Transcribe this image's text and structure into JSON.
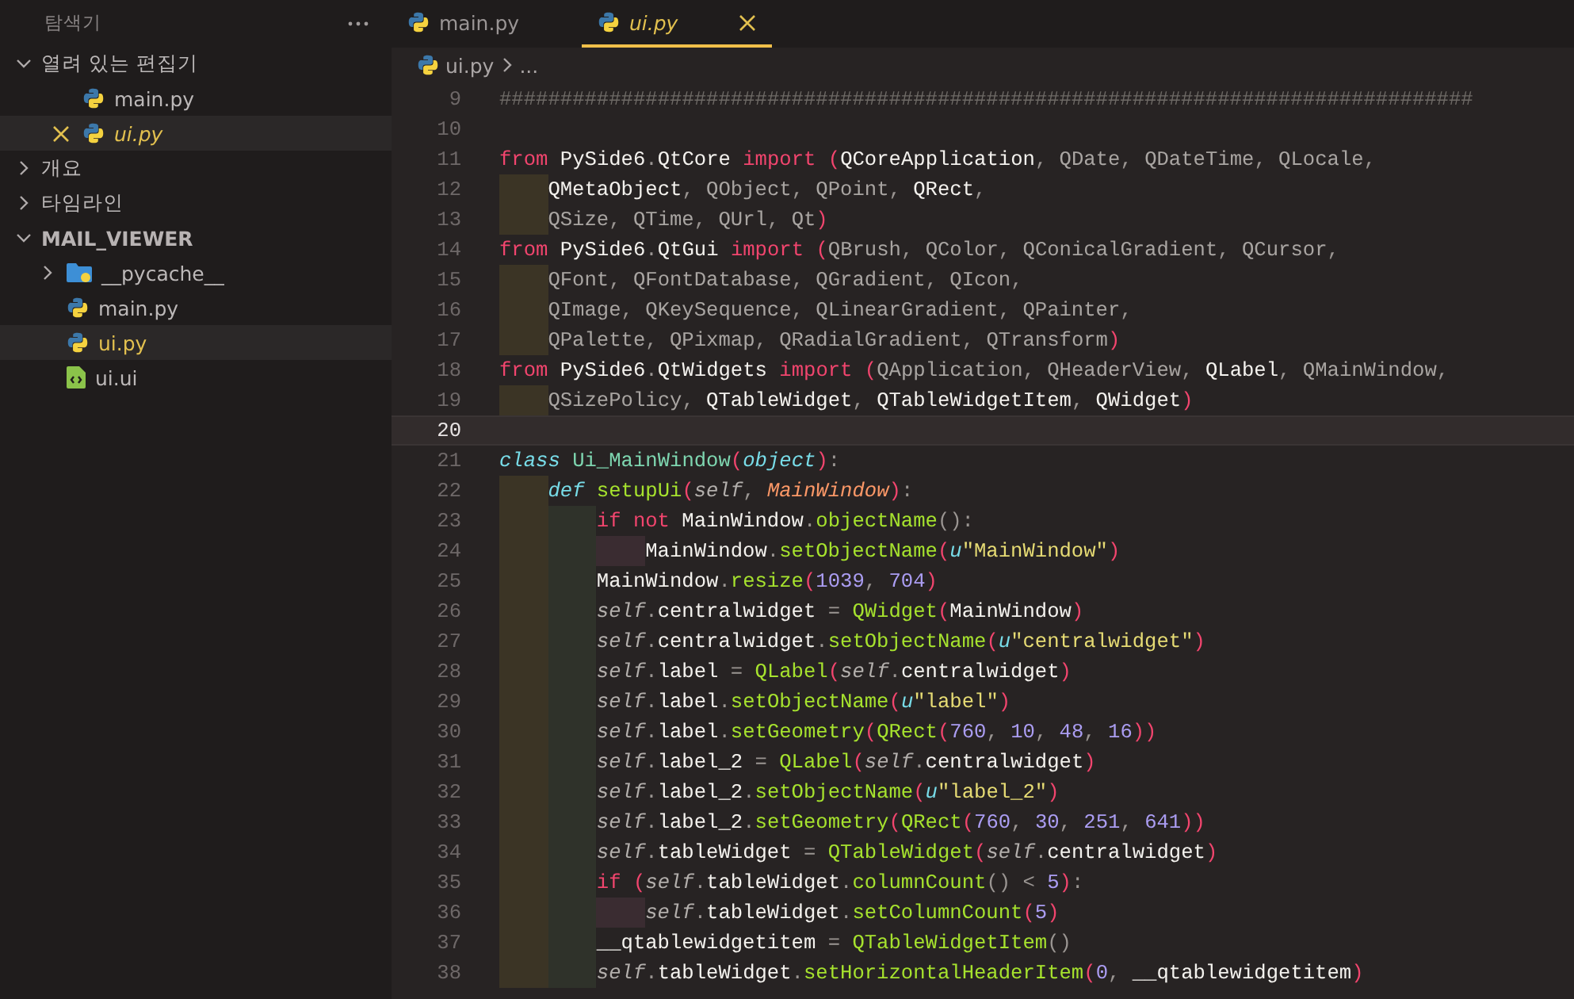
{
  "sidebar": {
    "title": "탐색기",
    "sections": [
      {
        "label": "열려 있는 편집기",
        "expanded": true,
        "bold": false,
        "items": [
          {
            "name": "main.py",
            "kind": "python",
            "selected": false,
            "modified": false,
            "preview": false,
            "close": false
          },
          {
            "name": "ui.py",
            "kind": "python",
            "selected": true,
            "modified": true,
            "preview": true,
            "close": true
          }
        ]
      },
      {
        "label": "개요",
        "expanded": false,
        "bold": false
      },
      {
        "label": "타임라인",
        "expanded": false,
        "bold": false
      },
      {
        "label": "MAIL_VIEWER",
        "expanded": true,
        "bold": true,
        "items": [
          {
            "name": "__pycache__",
            "kind": "folder",
            "expanded": false,
            "selected": false,
            "modified": false
          },
          {
            "name": "main.py",
            "kind": "python",
            "selected": false,
            "modified": false
          },
          {
            "name": "ui.py",
            "kind": "python",
            "selected": true,
            "modified": true
          },
          {
            "name": "ui.ui",
            "kind": "xml",
            "selected": false,
            "modified": false
          }
        ]
      }
    ]
  },
  "tabs": [
    {
      "label": "main.py",
      "selected": false,
      "preview": false,
      "modified": false
    },
    {
      "label": "ui.py",
      "selected": true,
      "preview": true,
      "modified": true
    }
  ],
  "breadcrumb": [
    "ui.py",
    "..."
  ],
  "lines": [
    {
      "number": "9",
      "current": false,
      "tokens": [
        {
          "kind": "cm",
          "text": "################################################################################"
        }
      ]
    },
    {
      "number": "10",
      "current": false
    },
    {
      "number": "11",
      "current": false,
      "tokens": [
        {
          "kind": "kw",
          "text": "from "
        },
        {
          "kind": "id",
          "text": "PySide6"
        },
        {
          "kind": "p",
          "text": "."
        },
        {
          "kind": "id",
          "text": "QtCore"
        },
        {
          "kind": "kw",
          "text": " import "
        },
        {
          "kind": "br",
          "text": "("
        },
        {
          "kind": "id",
          "text": "QCoreApplication"
        },
        {
          "kind": "p",
          "text": ", "
        },
        {
          "kind": "dim",
          "text": "QDate"
        },
        {
          "kind": "p",
          "text": ", "
        },
        {
          "kind": "dim",
          "text": "QDateTime"
        },
        {
          "kind": "p",
          "text": ", "
        },
        {
          "kind": "dim",
          "text": "QLocale"
        },
        {
          "kind": "p",
          "text": ","
        }
      ]
    },
    {
      "number": "12",
      "current": false,
      "guides": [
        {
          "color": "#3b3425"
        }
      ],
      "tokens": [
        {
          "kind": "id",
          "text": "QMetaObject"
        },
        {
          "kind": "p",
          "text": ", "
        },
        {
          "kind": "dim",
          "text": "QObject"
        },
        {
          "kind": "p",
          "text": ", "
        },
        {
          "kind": "dim",
          "text": "QPoint"
        },
        {
          "kind": "p",
          "text": ", "
        },
        {
          "kind": "id",
          "text": "QRect"
        },
        {
          "kind": "p",
          "text": ","
        }
      ]
    },
    {
      "number": "13",
      "current": false,
      "guides": [
        {
          "color": "#3b3425"
        }
      ],
      "tokens": [
        {
          "kind": "dim",
          "text": "QSize"
        },
        {
          "kind": "p",
          "text": ", "
        },
        {
          "kind": "dim",
          "text": "QTime"
        },
        {
          "kind": "p",
          "text": ", "
        },
        {
          "kind": "dim",
          "text": "QUrl"
        },
        {
          "kind": "p",
          "text": ", "
        },
        {
          "kind": "dim",
          "text": "Qt"
        },
        {
          "kind": "br",
          "text": ")"
        }
      ]
    },
    {
      "number": "14",
      "current": false,
      "tokens": [
        {
          "kind": "kw",
          "text": "from "
        },
        {
          "kind": "id",
          "text": "PySide6"
        },
        {
          "kind": "p",
          "text": "."
        },
        {
          "kind": "id",
          "text": "QtGui"
        },
        {
          "kind": "kw",
          "text": " import "
        },
        {
          "kind": "br",
          "text": "("
        },
        {
          "kind": "dim",
          "text": "QBrush"
        },
        {
          "kind": "p",
          "text": ", "
        },
        {
          "kind": "dim",
          "text": "QColor"
        },
        {
          "kind": "p",
          "text": ", "
        },
        {
          "kind": "dim",
          "text": "QConicalGradient"
        },
        {
          "kind": "p",
          "text": ", "
        },
        {
          "kind": "dim",
          "text": "QCursor"
        },
        {
          "kind": "p",
          "text": ","
        }
      ]
    },
    {
      "number": "15",
      "current": false,
      "guides": [
        {
          "color": "#3b3425"
        }
      ],
      "tokens": [
        {
          "kind": "dim",
          "text": "QFont"
        },
        {
          "kind": "p",
          "text": ", "
        },
        {
          "kind": "dim",
          "text": "QFontDatabase"
        },
        {
          "kind": "p",
          "text": ", "
        },
        {
          "kind": "dim",
          "text": "QGradient"
        },
        {
          "kind": "p",
          "text": ", "
        },
        {
          "kind": "dim",
          "text": "QIcon"
        },
        {
          "kind": "p",
          "text": ","
        }
      ]
    },
    {
      "number": "16",
      "current": false,
      "guides": [
        {
          "color": "#3b3425"
        }
      ],
      "tokens": [
        {
          "kind": "dim",
          "text": "QImage"
        },
        {
          "kind": "p",
          "text": ", "
        },
        {
          "kind": "dim",
          "text": "QKeySequence"
        },
        {
          "kind": "p",
          "text": ", "
        },
        {
          "kind": "dim",
          "text": "QLinearGradient"
        },
        {
          "kind": "p",
          "text": ", "
        },
        {
          "kind": "dim",
          "text": "QPainter"
        },
        {
          "kind": "p",
          "text": ","
        }
      ]
    },
    {
      "number": "17",
      "current": false,
      "guides": [
        {
          "color": "#3b3425"
        }
      ],
      "tokens": [
        {
          "kind": "dim",
          "text": "QPalette"
        },
        {
          "kind": "p",
          "text": ", "
        },
        {
          "kind": "dim",
          "text": "QPixmap"
        },
        {
          "kind": "p",
          "text": ", "
        },
        {
          "kind": "dim",
          "text": "QRadialGradient"
        },
        {
          "kind": "p",
          "text": ", "
        },
        {
          "kind": "dim",
          "text": "QTransform"
        },
        {
          "kind": "br",
          "text": ")"
        }
      ]
    },
    {
      "number": "18",
      "current": false,
      "tokens": [
        {
          "kind": "kw",
          "text": "from "
        },
        {
          "kind": "id",
          "text": "PySide6"
        },
        {
          "kind": "p",
          "text": "."
        },
        {
          "kind": "id",
          "text": "QtWidgets"
        },
        {
          "kind": "kw",
          "text": " import "
        },
        {
          "kind": "br",
          "text": "("
        },
        {
          "kind": "dim",
          "text": "QApplication"
        },
        {
          "kind": "p",
          "text": ", "
        },
        {
          "kind": "dim",
          "text": "QHeaderView"
        },
        {
          "kind": "p",
          "text": ", "
        },
        {
          "kind": "id",
          "text": "QLabel"
        },
        {
          "kind": "p",
          "text": ", "
        },
        {
          "kind": "dim",
          "text": "QMainWindow"
        },
        {
          "kind": "p",
          "text": ","
        }
      ]
    },
    {
      "number": "19",
      "current": false,
      "guides": [
        {
          "color": "#3b3425"
        }
      ],
      "tokens": [
        {
          "kind": "dim",
          "text": "QSizePolicy"
        },
        {
          "kind": "p",
          "text": ", "
        },
        {
          "kind": "id",
          "text": "QTableWidget"
        },
        {
          "kind": "p",
          "text": ", "
        },
        {
          "kind": "id",
          "text": "QTableWidgetItem"
        },
        {
          "kind": "p",
          "text": ", "
        },
        {
          "kind": "id",
          "text": "QWidget"
        },
        {
          "kind": "br",
          "text": ")"
        }
      ]
    },
    {
      "number": "20",
      "current": true
    },
    {
      "number": "21",
      "current": false,
      "tokens": [
        {
          "kind": "skw",
          "text": "class "
        },
        {
          "kind": "cls",
          "text": "Ui_MainWindow"
        },
        {
          "kind": "br",
          "text": "("
        },
        {
          "kind": "skw",
          "text": "object"
        },
        {
          "kind": "br",
          "text": ")"
        },
        {
          "kind": "p",
          "text": ":"
        }
      ]
    },
    {
      "number": "22",
      "current": false,
      "guides": [
        {
          "color": "#3b3425"
        }
      ],
      "tokens": [
        {
          "kind": "skw",
          "text": "def "
        },
        {
          "kind": "fn",
          "text": "setupUi"
        },
        {
          "kind": "br",
          "text": "("
        },
        {
          "kind": "self",
          "text": "self"
        },
        {
          "kind": "p",
          "text": ", "
        },
        {
          "kind": "param",
          "text": "MainWindow"
        },
        {
          "kind": "br",
          "text": ")"
        },
        {
          "kind": "p",
          "text": ":"
        }
      ]
    },
    {
      "number": "23",
      "current": false,
      "guides": [
        {
          "color": "#3b3425"
        },
        {
          "color": "#2f322a"
        }
      ],
      "tokens": [
        {
          "kind": "kw",
          "text": "if not "
        },
        {
          "kind": "id",
          "text": "MainWindow"
        },
        {
          "kind": "p",
          "text": "."
        },
        {
          "kind": "fn",
          "text": "objectName"
        },
        {
          "kind": "p",
          "text": "():"
        }
      ]
    },
    {
      "number": "24",
      "current": false,
      "guides": [
        {
          "color": "#3b3425"
        },
        {
          "color": "#2f322a"
        },
        {
          "color": "#3a2c31"
        }
      ],
      "tokens": [
        {
          "kind": "id",
          "text": "MainWindow"
        },
        {
          "kind": "p",
          "text": "."
        },
        {
          "kind": "fn",
          "text": "setObjectName"
        },
        {
          "kind": "br",
          "text": "("
        },
        {
          "kind": "skw",
          "text": "u"
        },
        {
          "kind": "str",
          "text": "\"MainWindow\""
        },
        {
          "kind": "br",
          "text": ")"
        }
      ]
    },
    {
      "number": "25",
      "current": false,
      "guides": [
        {
          "color": "#3b3425"
        },
        {
          "color": "#2f322a"
        }
      ],
      "tokens": [
        {
          "kind": "id",
          "text": "MainWindow"
        },
        {
          "kind": "p",
          "text": "."
        },
        {
          "kind": "fn",
          "text": "resize"
        },
        {
          "kind": "br",
          "text": "("
        },
        {
          "kind": "num",
          "text": "1039"
        },
        {
          "kind": "p",
          "text": ", "
        },
        {
          "kind": "num",
          "text": "704"
        },
        {
          "kind": "br",
          "text": ")"
        }
      ]
    },
    {
      "number": "26",
      "current": false,
      "guides": [
        {
          "color": "#3b3425"
        },
        {
          "color": "#2f322a"
        }
      ],
      "tokens": [
        {
          "kind": "self",
          "text": "self"
        },
        {
          "kind": "p",
          "text": "."
        },
        {
          "kind": "id",
          "text": "centralwidget"
        },
        {
          "kind": "p",
          "text": " = "
        },
        {
          "kind": "fn",
          "text": "QWidget"
        },
        {
          "kind": "br",
          "text": "("
        },
        {
          "kind": "id",
          "text": "MainWindow"
        },
        {
          "kind": "br",
          "text": ")"
        }
      ]
    },
    {
      "number": "27",
      "current": false,
      "guides": [
        {
          "color": "#3b3425"
        },
        {
          "color": "#2f322a"
        }
      ],
      "tokens": [
        {
          "kind": "self",
          "text": "self"
        },
        {
          "kind": "p",
          "text": "."
        },
        {
          "kind": "id",
          "text": "centralwidget"
        },
        {
          "kind": "p",
          "text": "."
        },
        {
          "kind": "fn",
          "text": "setObjectName"
        },
        {
          "kind": "br",
          "text": "("
        },
        {
          "kind": "skw",
          "text": "u"
        },
        {
          "kind": "str",
          "text": "\"centralwidget\""
        },
        {
          "kind": "br",
          "text": ")"
        }
      ]
    },
    {
      "number": "28",
      "current": false,
      "guides": [
        {
          "color": "#3b3425"
        },
        {
          "color": "#2f322a"
        }
      ],
      "tokens": [
        {
          "kind": "self",
          "text": "self"
        },
        {
          "kind": "p",
          "text": "."
        },
        {
          "kind": "id",
          "text": "label"
        },
        {
          "kind": "p",
          "text": " = "
        },
        {
          "kind": "fn",
          "text": "QLabel"
        },
        {
          "kind": "br",
          "text": "("
        },
        {
          "kind": "self",
          "text": "self"
        },
        {
          "kind": "p",
          "text": "."
        },
        {
          "kind": "id",
          "text": "centralwidget"
        },
        {
          "kind": "br",
          "text": ")"
        }
      ]
    },
    {
      "number": "29",
      "current": false,
      "guides": [
        {
          "color": "#3b3425"
        },
        {
          "color": "#2f322a"
        }
      ],
      "tokens": [
        {
          "kind": "self",
          "text": "self"
        },
        {
          "kind": "p",
          "text": "."
        },
        {
          "kind": "id",
          "text": "label"
        },
        {
          "kind": "p",
          "text": "."
        },
        {
          "kind": "fn",
          "text": "setObjectName"
        },
        {
          "kind": "br",
          "text": "("
        },
        {
          "kind": "skw",
          "text": "u"
        },
        {
          "kind": "str",
          "text": "\"label\""
        },
        {
          "kind": "br",
          "text": ")"
        }
      ]
    },
    {
      "number": "30",
      "current": false,
      "guides": [
        {
          "color": "#3b3425"
        },
        {
          "color": "#2f322a"
        }
      ],
      "tokens": [
        {
          "kind": "self",
          "text": "self"
        },
        {
          "kind": "p",
          "text": "."
        },
        {
          "kind": "id",
          "text": "label"
        },
        {
          "kind": "p",
          "text": "."
        },
        {
          "kind": "fn",
          "text": "setGeometry"
        },
        {
          "kind": "br",
          "text": "("
        },
        {
          "kind": "fn",
          "text": "QRect"
        },
        {
          "kind": "br",
          "text": "("
        },
        {
          "kind": "num",
          "text": "760"
        },
        {
          "kind": "p",
          "text": ", "
        },
        {
          "kind": "num",
          "text": "10"
        },
        {
          "kind": "p",
          "text": ", "
        },
        {
          "kind": "num",
          "text": "48"
        },
        {
          "kind": "p",
          "text": ", "
        },
        {
          "kind": "num",
          "text": "16"
        },
        {
          "kind": "br",
          "text": "))"
        }
      ]
    },
    {
      "number": "31",
      "current": false,
      "guides": [
        {
          "color": "#3b3425"
        },
        {
          "color": "#2f322a"
        }
      ],
      "tokens": [
        {
          "kind": "self",
          "text": "self"
        },
        {
          "kind": "p",
          "text": "."
        },
        {
          "kind": "id",
          "text": "label_2"
        },
        {
          "kind": "p",
          "text": " = "
        },
        {
          "kind": "fn",
          "text": "QLabel"
        },
        {
          "kind": "br",
          "text": "("
        },
        {
          "kind": "self",
          "text": "self"
        },
        {
          "kind": "p",
          "text": "."
        },
        {
          "kind": "id",
          "text": "centralwidget"
        },
        {
          "kind": "br",
          "text": ")"
        }
      ]
    },
    {
      "number": "32",
      "current": false,
      "guides": [
        {
          "color": "#3b3425"
        },
        {
          "color": "#2f322a"
        }
      ],
      "tokens": [
        {
          "kind": "self",
          "text": "self"
        },
        {
          "kind": "p",
          "text": "."
        },
        {
          "kind": "id",
          "text": "label_2"
        },
        {
          "kind": "p",
          "text": "."
        },
        {
          "kind": "fn",
          "text": "setObjectName"
        },
        {
          "kind": "br",
          "text": "("
        },
        {
          "kind": "skw",
          "text": "u"
        },
        {
          "kind": "str",
          "text": "\"label_2\""
        },
        {
          "kind": "br",
          "text": ")"
        }
      ]
    },
    {
      "number": "33",
      "current": false,
      "guides": [
        {
          "color": "#3b3425"
        },
        {
          "color": "#2f322a"
        }
      ],
      "tokens": [
        {
          "kind": "self",
          "text": "self"
        },
        {
          "kind": "p",
          "text": "."
        },
        {
          "kind": "id",
          "text": "label_2"
        },
        {
          "kind": "p",
          "text": "."
        },
        {
          "kind": "fn",
          "text": "setGeometry"
        },
        {
          "kind": "br",
          "text": "("
        },
        {
          "kind": "fn",
          "text": "QRect"
        },
        {
          "kind": "br",
          "text": "("
        },
        {
          "kind": "num",
          "text": "760"
        },
        {
          "kind": "p",
          "text": ", "
        },
        {
          "kind": "num",
          "text": "30"
        },
        {
          "kind": "p",
          "text": ", "
        },
        {
          "kind": "num",
          "text": "251"
        },
        {
          "kind": "p",
          "text": ", "
        },
        {
          "kind": "num",
          "text": "641"
        },
        {
          "kind": "br",
          "text": "))"
        }
      ]
    },
    {
      "number": "34",
      "current": false,
      "guides": [
        {
          "color": "#3b3425"
        },
        {
          "color": "#2f322a"
        }
      ],
      "tokens": [
        {
          "kind": "self",
          "text": "self"
        },
        {
          "kind": "p",
          "text": "."
        },
        {
          "kind": "id",
          "text": "tableWidget"
        },
        {
          "kind": "p",
          "text": " = "
        },
        {
          "kind": "fn",
          "text": "QTableWidget"
        },
        {
          "kind": "br",
          "text": "("
        },
        {
          "kind": "self",
          "text": "self"
        },
        {
          "kind": "p",
          "text": "."
        },
        {
          "kind": "id",
          "text": "centralwidget"
        },
        {
          "kind": "br",
          "text": ")"
        }
      ]
    },
    {
      "number": "35",
      "current": false,
      "guides": [
        {
          "color": "#3b3425"
        },
        {
          "color": "#2f322a"
        }
      ],
      "tokens": [
        {
          "kind": "kw",
          "text": "if "
        },
        {
          "kind": "br",
          "text": "("
        },
        {
          "kind": "self",
          "text": "self"
        },
        {
          "kind": "p",
          "text": "."
        },
        {
          "kind": "id",
          "text": "tableWidget"
        },
        {
          "kind": "p",
          "text": "."
        },
        {
          "kind": "fn",
          "text": "columnCount"
        },
        {
          "kind": "p",
          "text": "() < "
        },
        {
          "kind": "num",
          "text": "5"
        },
        {
          "kind": "br",
          "text": ")"
        },
        {
          "kind": "p",
          "text": ":"
        }
      ]
    },
    {
      "number": "36",
      "current": false,
      "guides": [
        {
          "color": "#3b3425"
        },
        {
          "color": "#2f322a"
        },
        {
          "color": "#3a2c31"
        }
      ],
      "tokens": [
        {
          "kind": "self",
          "text": "self"
        },
        {
          "kind": "p",
          "text": "."
        },
        {
          "kind": "id",
          "text": "tableWidget"
        },
        {
          "kind": "p",
          "text": "."
        },
        {
          "kind": "fn",
          "text": "setColumnCount"
        },
        {
          "kind": "br",
          "text": "("
        },
        {
          "kind": "num",
          "text": "5"
        },
        {
          "kind": "br",
          "text": ")"
        }
      ]
    },
    {
      "number": "37",
      "current": false,
      "guides": [
        {
          "color": "#3b3425"
        },
        {
          "color": "#2f322a"
        }
      ],
      "tokens": [
        {
          "kind": "id",
          "text": "__qtablewidgetitem"
        },
        {
          "kind": "p",
          "text": " = "
        },
        {
          "kind": "fn",
          "text": "QTableWidgetItem"
        },
        {
          "kind": "p",
          "text": "()"
        }
      ]
    },
    {
      "number": "38",
      "current": false,
      "guides": [
        {
          "color": "#3b3425"
        },
        {
          "color": "#2f322a"
        }
      ],
      "tokens": [
        {
          "kind": "self",
          "text": "self"
        },
        {
          "kind": "p",
          "text": "."
        },
        {
          "kind": "id",
          "text": "tableWidget"
        },
        {
          "kind": "p",
          "text": "."
        },
        {
          "kind": "fn",
          "text": "setHorizontalHeaderItem"
        },
        {
          "kind": "br",
          "text": "("
        },
        {
          "kind": "num",
          "text": "0"
        },
        {
          "kind": "p",
          "text": ", "
        },
        {
          "kind": "id",
          "text": "__qtablewidgetitem"
        },
        {
          "kind": "br",
          "text": ")"
        }
      ]
    }
  ]
}
